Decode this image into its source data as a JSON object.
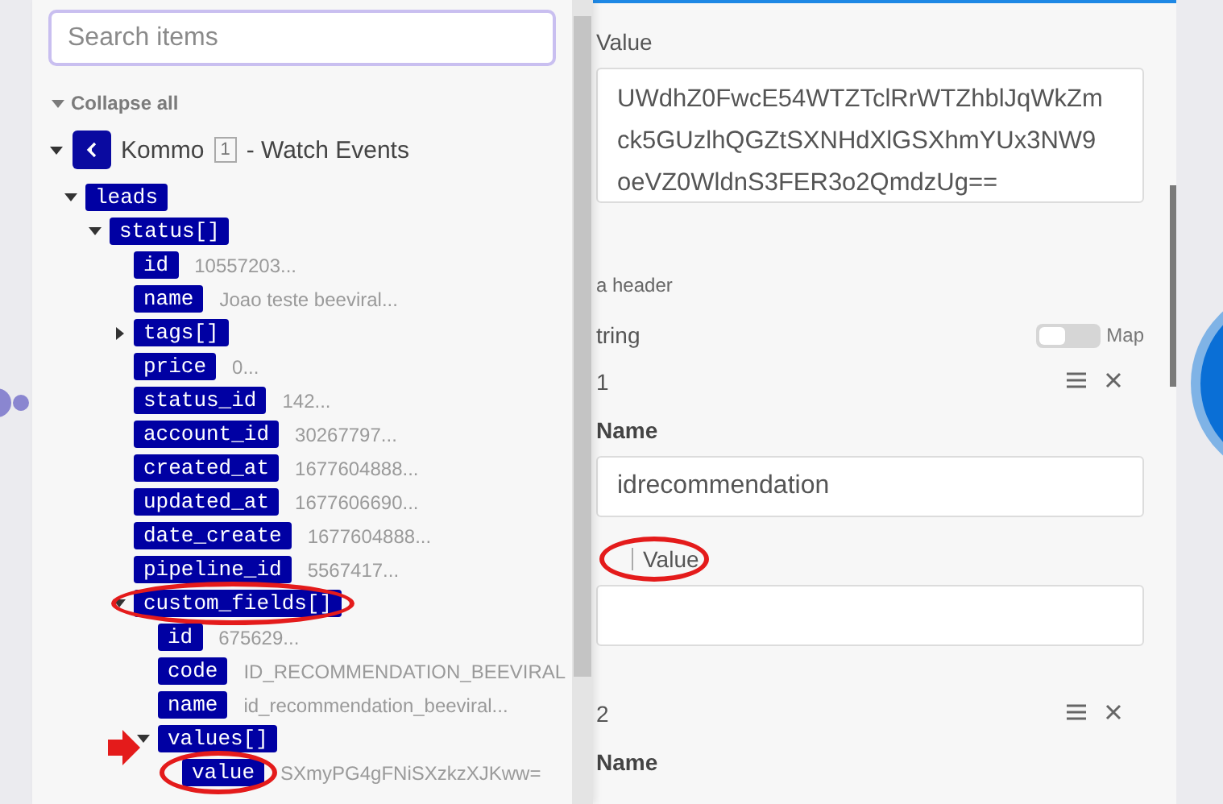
{
  "picker": {
    "search": {
      "placeholder": "Search items"
    },
    "collapse_all": {
      "label": "Collapse all"
    },
    "module": {
      "name": "Kommo",
      "badge": "1",
      "label": "- Watch Events",
      "expanded": true
    },
    "tree": [
      {
        "key": "leads",
        "expanded": true,
        "circled": false,
        "arrowed": false,
        "children": [
          {
            "key": "status[]",
            "expanded": true,
            "circled": false,
            "arrowed": false,
            "children": [
              {
                "key": "id",
                "value": "10557203...",
                "circled": false,
                "arrowed": false
              },
              {
                "key": "name",
                "value": "Joao teste beeviral...",
                "circled": false,
                "arrowed": false
              },
              {
                "key": "tags[]",
                "expanded": false,
                "circled": false,
                "arrowed": false
              },
              {
                "key": "price",
                "value": "0...",
                "circled": false,
                "arrowed": false
              },
              {
                "key": "status_id",
                "value": "142...",
                "circled": false,
                "arrowed": false
              },
              {
                "key": "account_id",
                "value": "30267797...",
                "circled": false,
                "arrowed": false
              },
              {
                "key": "created_at",
                "value": "1677604888...",
                "circled": false,
                "arrowed": false
              },
              {
                "key": "updated_at",
                "value": "1677606690...",
                "circled": false,
                "arrowed": false
              },
              {
                "key": "date_create",
                "value": "1677604888...",
                "circled": false,
                "arrowed": false
              },
              {
                "key": "pipeline_id",
                "value": "5567417...",
                "circled": false,
                "arrowed": false
              },
              {
                "key": "custom_fields[]",
                "expanded": true,
                "circled": true,
                "arrowed": false,
                "children": [
                  {
                    "key": "id",
                    "value": "675629...",
                    "circled": false,
                    "arrowed": false
                  },
                  {
                    "key": "code",
                    "value": "ID_RECOMMENDATION_BEEVIRAL",
                    "circled": false,
                    "arrowed": false
                  },
                  {
                    "key": "name",
                    "value": "id_recommendation_beeviral...",
                    "circled": false,
                    "arrowed": false
                  },
                  {
                    "key": "values[]",
                    "expanded": true,
                    "circled": false,
                    "arrowed": true,
                    "children": [
                      {
                        "key": "value",
                        "value": "SXmyPG4gFNiSXzkzXJKww=",
                        "circled": true,
                        "arrowed": false
                      }
                    ]
                  }
                ]
              }
            ]
          }
        ]
      }
    ]
  },
  "mapper": {
    "value_label": "Value",
    "value_text": "UWdhZ0FwcE54WTZTclRrWTZhblJqWkZmck5GUzlhQGZtSXNHdXlGSXhmYUx3NW9oeVZ0WldnS3FER3o2QmdzUg==",
    "header_hint": "a header",
    "type_label": "tring",
    "map_toggle": {
      "label": "Map",
      "on": false
    },
    "items": [
      {
        "title": "1",
        "name_label": "Name",
        "name_value": "idrecommendation",
        "value_label": "Value",
        "value_circled": true
      },
      {
        "title": "2",
        "name_label": "Name"
      }
    ]
  }
}
